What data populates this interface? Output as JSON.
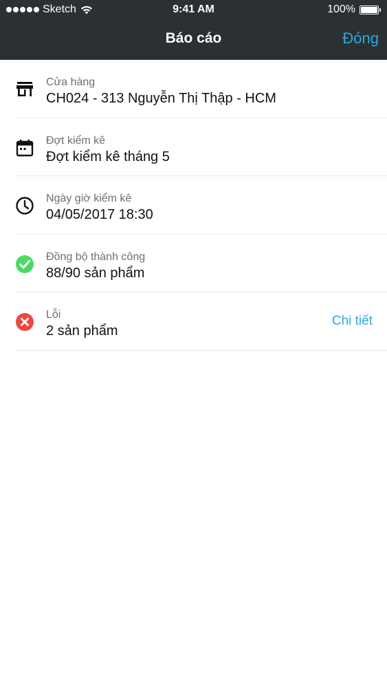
{
  "status_bar": {
    "carrier": "Sketch",
    "time": "9:41 AM",
    "battery_percent": "100%"
  },
  "nav": {
    "title": "Báo cáo",
    "close_label": "Đóng"
  },
  "rows": [
    {
      "icon": "store-icon",
      "label": "Cửa hàng",
      "value": "CH024 - 313 Nguyễn Thị Thập - HCM"
    },
    {
      "icon": "calendar-icon",
      "label": "Đợt kiểm kê",
      "value": "Đợt kiểm kê tháng 5"
    },
    {
      "icon": "clock-icon",
      "label": "Ngày giờ kiểm kê",
      "value": "04/05/2017 18:30"
    },
    {
      "icon": "check-circle-icon",
      "label": "Đồng bộ thành công",
      "value": "88/90 sản phẩm"
    },
    {
      "icon": "error-circle-icon",
      "label": "Lỗi",
      "value": "2 sản phẩm",
      "action": "Chi tiết"
    }
  ],
  "colors": {
    "header_bg": "#2a3033",
    "accent": "#2ea8e0",
    "success": "#4cd964",
    "error": "#f0483e"
  }
}
